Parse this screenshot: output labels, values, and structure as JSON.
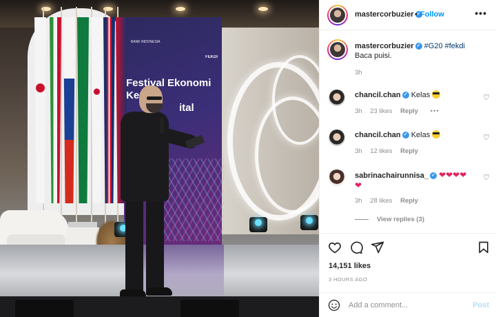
{
  "post": {
    "username": "mastercorbuzier",
    "follow_label": "Follow",
    "separator": "•",
    "more_label": "•••",
    "caption": {
      "username": "mastercorbuzier",
      "hashtags": "#G20 #fekdi",
      "text": "Baca puisi.",
      "time": "3h"
    },
    "likes": "14,151 likes",
    "time_ago": "3 HOURS AGO"
  },
  "photo": {
    "backdrop_line1": "Festival Ekonomi",
    "backdrop_line2": "Keua",
    "backdrop_line3": "ital",
    "backdrop_brand": "BANK INDONESIA",
    "backdrop_logo": "FEKDI"
  },
  "comments": [
    {
      "username": "chancil.chan",
      "text": "Kelas",
      "emoji": "cool-face-emoji",
      "time": "3h",
      "likes": "23 likes",
      "reply_label": "Reply",
      "extra": "•••"
    },
    {
      "username": "chancil.chan",
      "text": "Kelas",
      "emoji": "cool-face-emoji",
      "time": "3h",
      "likes": "12 likes",
      "reply_label": "Reply"
    },
    {
      "username": "sabrinachairunnisa_",
      "text": "",
      "hearts": "❤❤❤❤",
      "hearts2": "❤",
      "time": "3h",
      "likes": "28 likes",
      "reply_label": "Reply"
    }
  ],
  "view_replies": "View replies (3)",
  "add_comment": {
    "placeholder": "Add a comment...",
    "post_label": "Post"
  },
  "icons": {
    "like": "heart-icon",
    "comment": "comment-icon",
    "share": "share-icon",
    "save": "bookmark-icon",
    "emoji": "emoji-icon"
  },
  "colors": {
    "accent": "#0095f6",
    "verified": "#3897f0",
    "post_disabled": "#b2dffc",
    "heart": "#e0245e"
  }
}
